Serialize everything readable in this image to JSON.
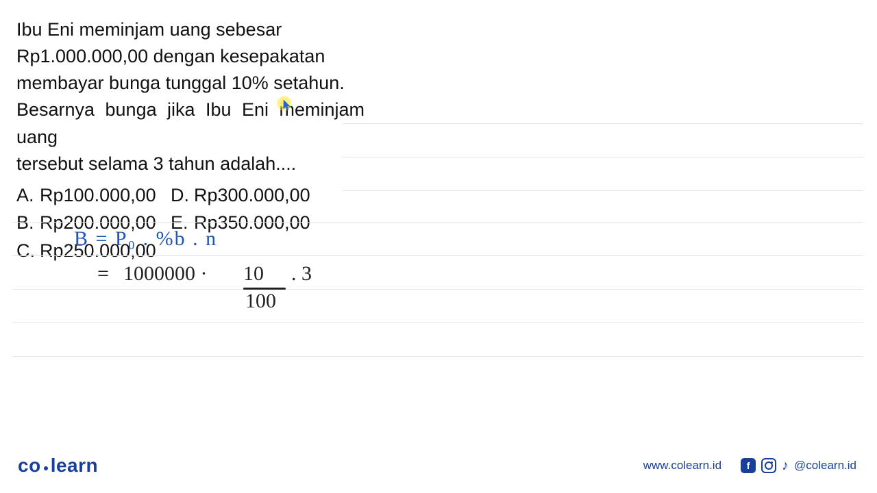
{
  "problem": {
    "line1": "Ibu Eni meminjam uang sebesar",
    "line2": "Rp1.000.000,00 dengan kesepakatan",
    "line3": "membayar bunga tunggal 10% setahun.",
    "line4": "Besarnya bunga jika Ibu Eni meminjam uang",
    "line5": "tersebut selama 3 tahun adalah...."
  },
  "options": {
    "A": "Rp100.000,00",
    "B": "Rp200.000,00",
    "C": "Rp250.000,00",
    "D": "Rp300.000,00",
    "E": "Rp350.000,00"
  },
  "handwriting": {
    "formula": "B = P₀ . %b . n",
    "eq_sign": "=",
    "principal": "1000000 ·",
    "frac_top": "10",
    "frac_bot": "100",
    "tail": ". 3"
  },
  "footer": {
    "logo_left": "co",
    "logo_right": "learn",
    "url": "www.colearn.id",
    "handle": "@colearn.id",
    "fb_glyph": "f",
    "tiktok_glyph": "♪"
  }
}
